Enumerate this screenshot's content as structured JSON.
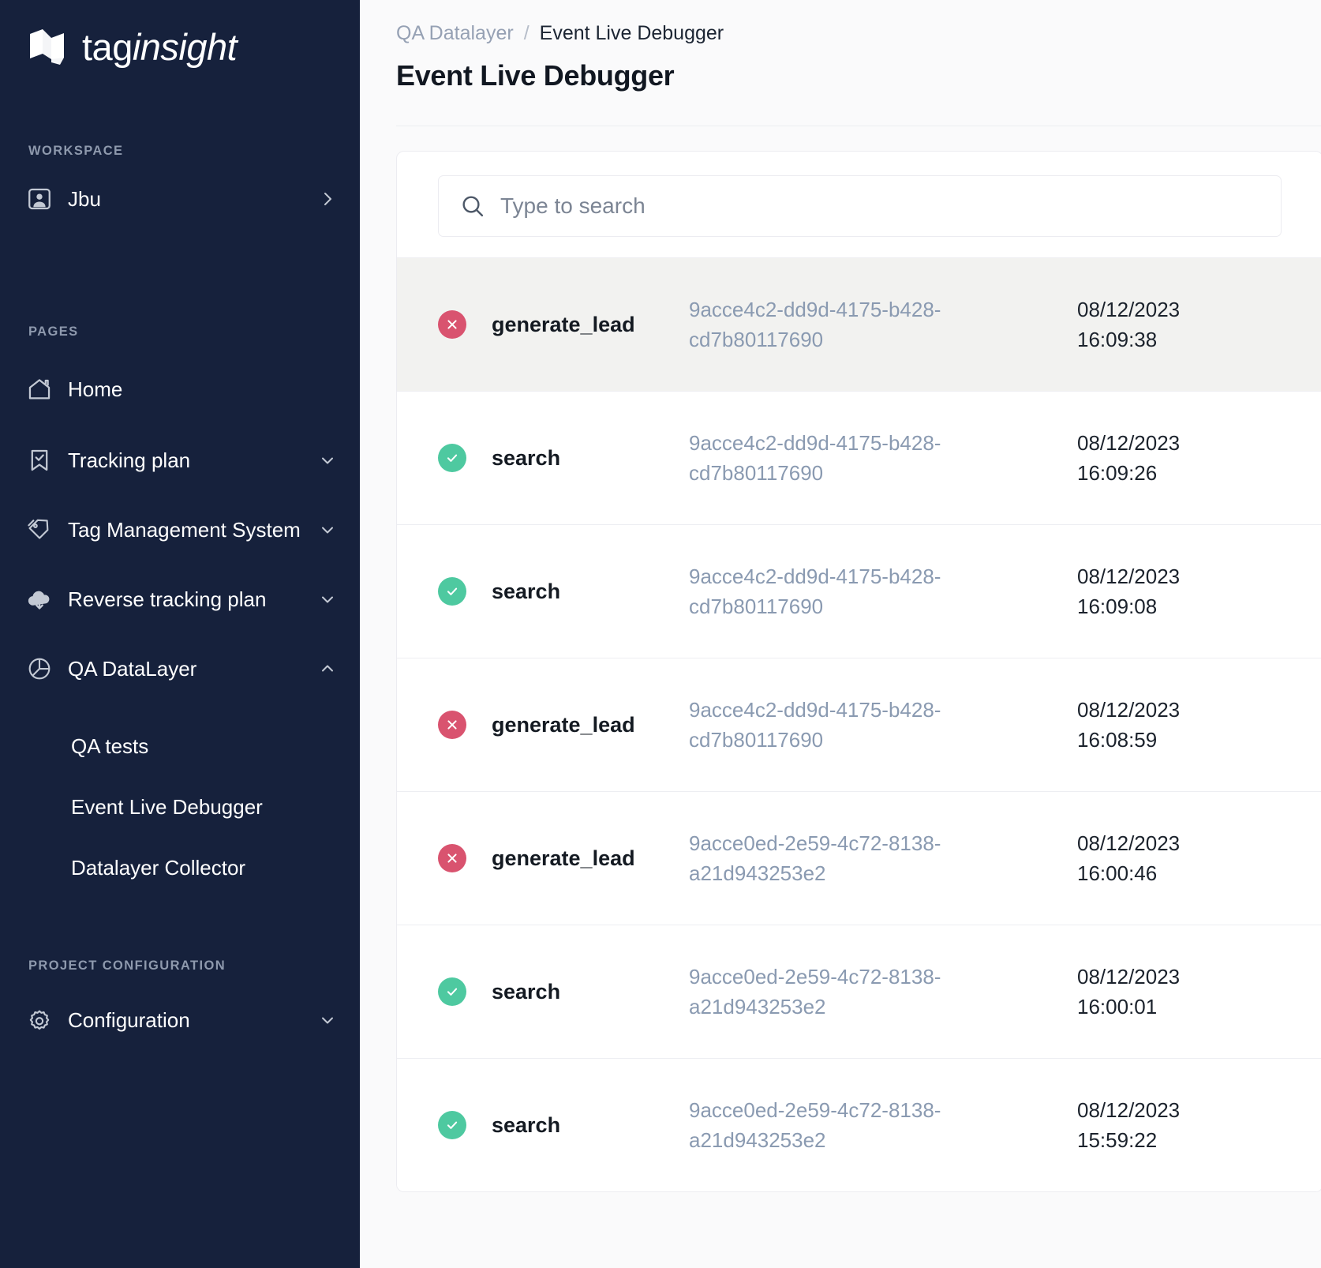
{
  "brand": {
    "name": "taginsight",
    "name_part1": "tag",
    "name_part2": "insight",
    "logo_icon": "taginsight-logo-mark"
  },
  "sidebar": {
    "workspace_section_label": "WORKSPACE",
    "workspace": {
      "label": "Jbu",
      "icon": "user-card-icon",
      "chevron": "chevron-right-icon"
    },
    "pages_section_label": "PAGES",
    "items": [
      {
        "label": "Home",
        "icon": "home-icon",
        "chevron": null
      },
      {
        "label": "Tracking plan",
        "icon": "bookmark-check-icon",
        "chevron": "chevron-down-icon"
      },
      {
        "label": "Tag Management System",
        "icon": "tag-icon",
        "chevron": "chevron-down-icon"
      },
      {
        "label": "Reverse tracking plan",
        "icon": "cloud-download-icon",
        "chevron": "chevron-down-icon"
      },
      {
        "label": "QA DataLayer",
        "icon": "pie-chart-icon",
        "chevron": "chevron-up-icon"
      }
    ],
    "qa_datalayer_children": [
      {
        "label": "QA tests"
      },
      {
        "label": "Event Live Debugger"
      },
      {
        "label": "Datalayer Collector"
      }
    ],
    "project_config_section_label": "PROJECT CONFIGURATION",
    "configuration": {
      "label": "Configuration",
      "icon": "gear-icon",
      "chevron": "chevron-down-icon"
    }
  },
  "header": {
    "breadcrumb_parent": "QA Datalayer",
    "breadcrumb_separator": "/",
    "breadcrumb_current": "Event Live Debugger",
    "title": "Event Live Debugger"
  },
  "search": {
    "placeholder": "Type to search",
    "value": "",
    "icon": "search-icon"
  },
  "colors": {
    "sidebar_bg": "#16213c",
    "error": "#d9536f",
    "success": "#4ec9a0",
    "uid_text": "#8a9ab1",
    "selected_row_bg": "#f2f2f0"
  },
  "events": [
    {
      "status": "error",
      "status_icon": "circle-x-icon",
      "name": "generate_lead",
      "uid": "9acce4c2-dd9d-4175-b428-cd7b80117690",
      "date": "08/12/2023",
      "time": "16:09:38",
      "selected": true
    },
    {
      "status": "success",
      "status_icon": "circle-check-icon",
      "name": "search",
      "uid": "9acce4c2-dd9d-4175-b428-cd7b80117690",
      "date": "08/12/2023",
      "time": "16:09:26",
      "selected": false
    },
    {
      "status": "success",
      "status_icon": "circle-check-icon",
      "name": "search",
      "uid": "9acce4c2-dd9d-4175-b428-cd7b80117690",
      "date": "08/12/2023",
      "time": "16:09:08",
      "selected": false
    },
    {
      "status": "error",
      "status_icon": "circle-x-icon",
      "name": "generate_lead",
      "uid": "9acce4c2-dd9d-4175-b428-cd7b80117690",
      "date": "08/12/2023",
      "time": "16:08:59",
      "selected": false
    },
    {
      "status": "error",
      "status_icon": "circle-x-icon",
      "name": "generate_lead",
      "uid": "9acce0ed-2e59-4c72-8138-a21d943253e2",
      "date": "08/12/2023",
      "time": "16:00:46",
      "selected": false
    },
    {
      "status": "success",
      "status_icon": "circle-check-icon",
      "name": "search",
      "uid": "9acce0ed-2e59-4c72-8138-a21d943253e2",
      "date": "08/12/2023",
      "time": "16:00:01",
      "selected": false
    },
    {
      "status": "success",
      "status_icon": "circle-check-icon",
      "name": "search",
      "uid": "9acce0ed-2e59-4c72-8138-a21d943253e2",
      "date": "08/12/2023",
      "time": "15:59:22",
      "selected": false
    }
  ]
}
